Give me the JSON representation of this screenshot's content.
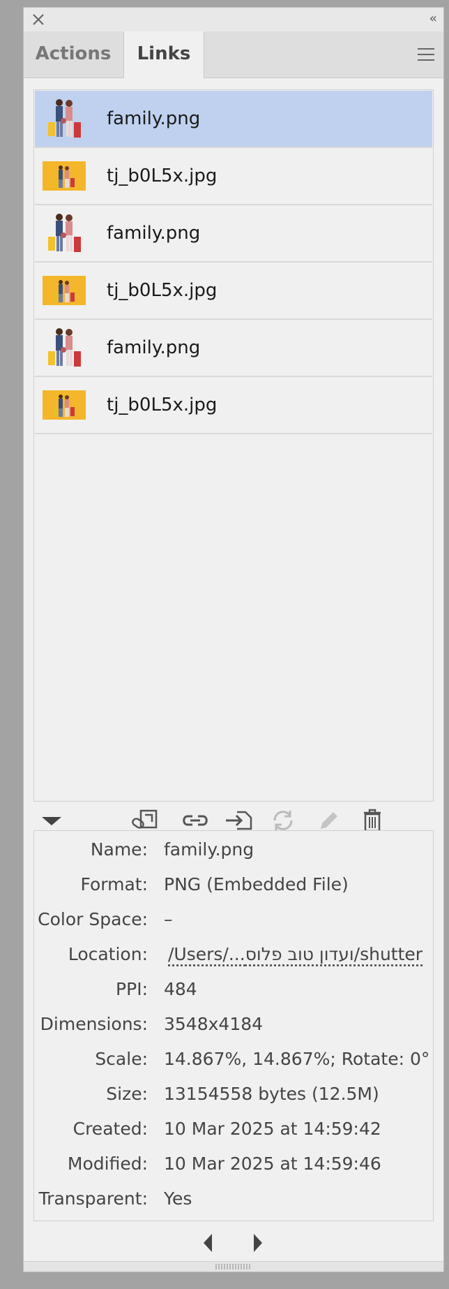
{
  "tabs": [
    {
      "label": "Actions"
    },
    {
      "label": "Links"
    }
  ],
  "links": [
    {
      "name": "family.png",
      "thumb": "family-thumbnail",
      "selected": true
    },
    {
      "name": "tj_b0L5x.jpg",
      "thumb": "yellow-thumbnail",
      "selected": false
    },
    {
      "name": "family.png",
      "thumb": "family-thumbnail",
      "selected": false
    },
    {
      "name": "tj_b0L5x.jpg",
      "thumb": "yellow-thumbnail",
      "selected": false
    },
    {
      "name": "family.png",
      "thumb": "family-thumbnail",
      "selected": false
    },
    {
      "name": "tj_b0L5x.jpg",
      "thumb": "yellow-thumbnail",
      "selected": false
    }
  ],
  "toolbar": {
    "icons": [
      "disclosure-triangle-icon",
      "relink-from-cc-icon",
      "relink-icon",
      "go-to-link-icon",
      "update-link-icon",
      "edit-original-icon",
      "delete-icon"
    ]
  },
  "info": [
    {
      "label": "Name:",
      "value": "family.png"
    },
    {
      "label": "Format:",
      "value": "PNG (Embedded File)"
    },
    {
      "label": "Color Space:",
      "value": "–"
    },
    {
      "label": "Location:",
      "value": "/Users/...ועדון טוב פלוס/shutter"
    },
    {
      "label": "PPI:",
      "value": "484"
    },
    {
      "label": "Dimensions:",
      "value": "3548x4184"
    },
    {
      "label": "Scale:",
      "value": "14.867%, 14.867%; Rotate: 0°"
    },
    {
      "label": "Size:",
      "value": "13154558 bytes (12.5M)"
    },
    {
      "label": "Created:",
      "value": "10 Mar 2025 at 14:59:42"
    },
    {
      "label": "Modified:",
      "value": "10 Mar 2025 at 14:59:46"
    },
    {
      "label": "Transparent:",
      "value": "Yes"
    }
  ],
  "colors": {
    "selection": "#bfd1ee",
    "thumb_yellow": "#f4b62a",
    "panel_bg": "#f0f0f0"
  }
}
